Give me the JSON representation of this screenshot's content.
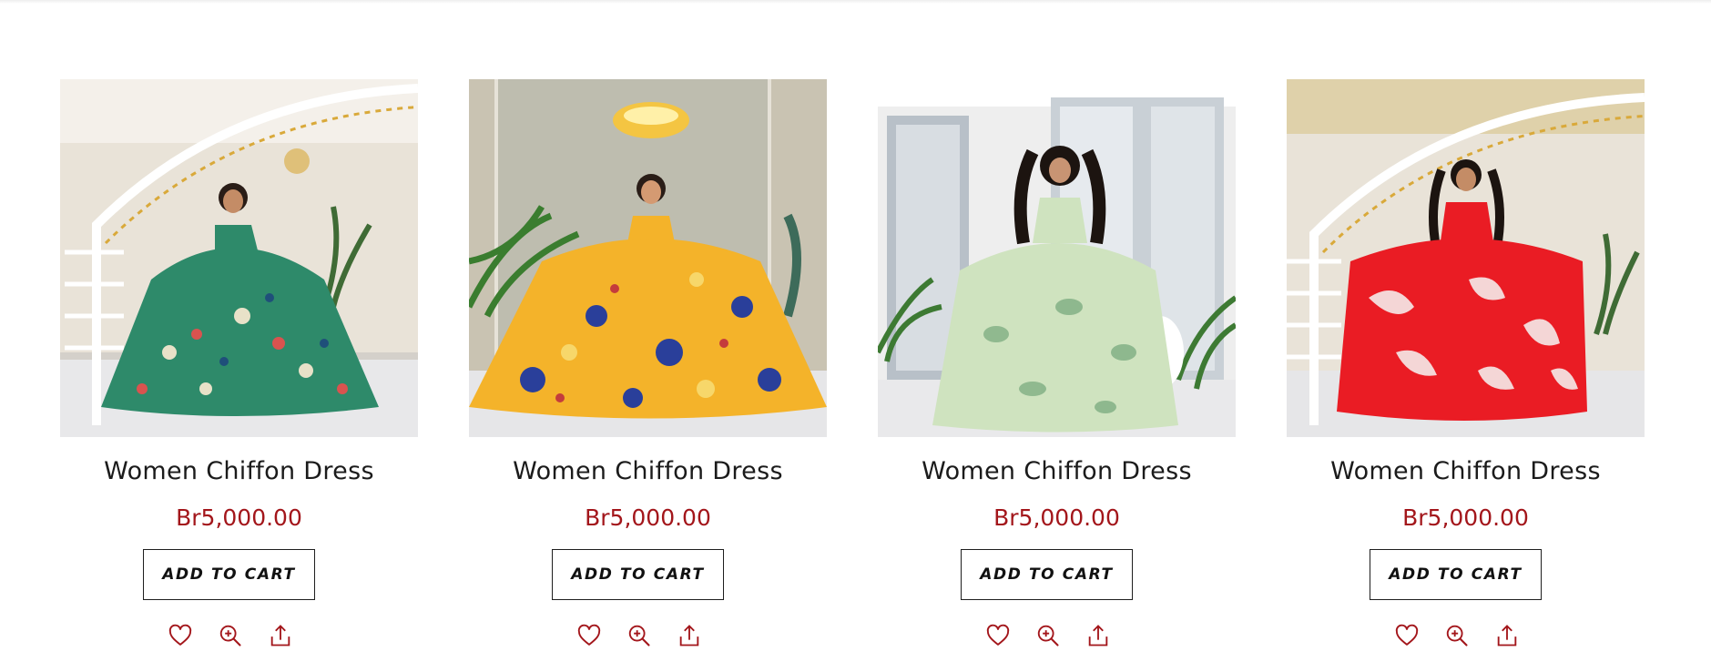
{
  "products": [
    {
      "title": "Women Chiffon Dress",
      "price": "Br5,000.00",
      "cart_label": "ADD TO CART",
      "scene": "staircase",
      "dress_colors": {
        "base": "#2e8a6a",
        "accent1": "#e8e1c8",
        "accent2": "#d9534f",
        "accent3": "#1f4f7a"
      }
    },
    {
      "title": "Women Chiffon Dress",
      "price": "Br5,000.00",
      "cart_label": "ADD TO CART",
      "scene": "chandelier",
      "dress_colors": {
        "base": "#f4b32a",
        "accent1": "#2a3f9a",
        "accent2": "#f7d76a",
        "accent3": "#c43c3c"
      }
    },
    {
      "title": "Women Chiffon Dress",
      "price": "Br5,000.00",
      "cart_label": "ADD TO CART",
      "scene": "window",
      "dress_colors": {
        "base": "#cfe3bf",
        "accent1": "#7fae83",
        "accent2": "#e6f0dc",
        "accent3": "#9cc29a"
      }
    },
    {
      "title": "Women Chiffon Dress",
      "price": "Br5,000.00",
      "cart_label": "ADD TO CART",
      "scene": "staircase",
      "dress_colors": {
        "base": "#ea1c24",
        "accent1": "#f4d6d6",
        "accent2": "#c8101a",
        "accent3": "#ffffff"
      }
    }
  ],
  "icons": [
    "heart-icon",
    "zoom-in-icon",
    "share-icon"
  ],
  "colors": {
    "price": "#a3161b",
    "icon": "#a3161b"
  }
}
